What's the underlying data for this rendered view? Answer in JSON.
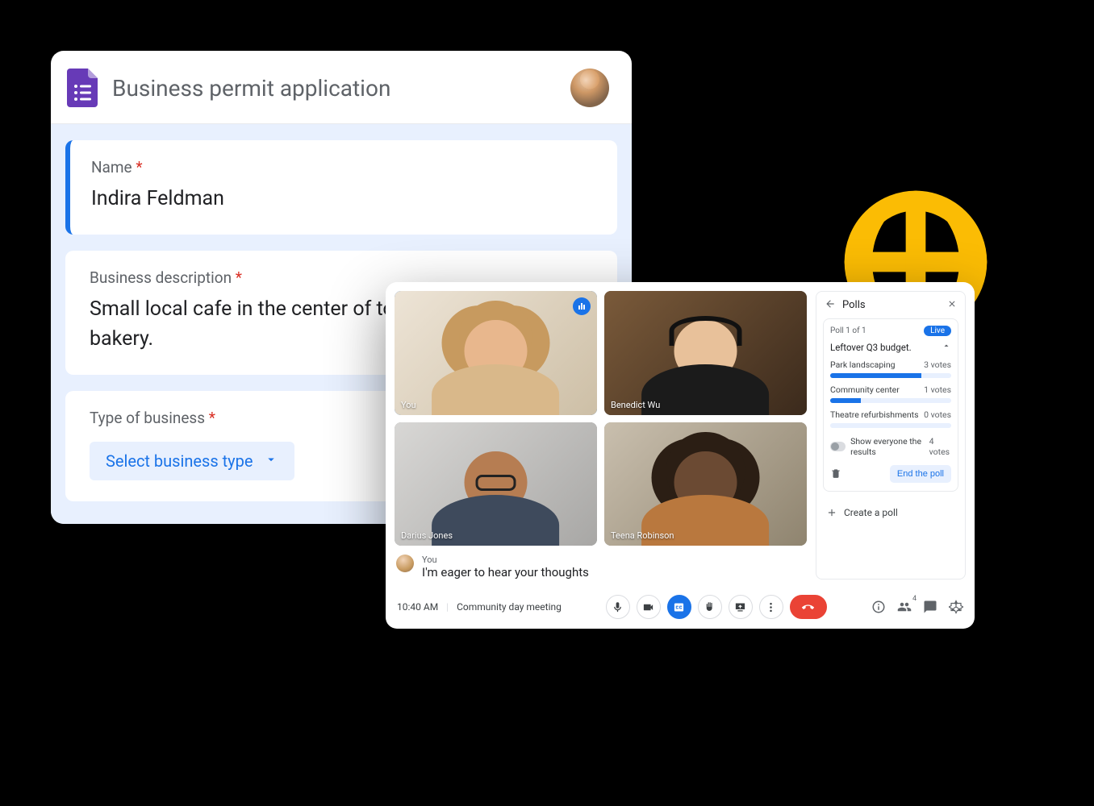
{
  "form": {
    "title": "Business permit application",
    "questions": {
      "name": {
        "label": "Name",
        "required": "*",
        "value": "Indira Feldman"
      },
      "desc": {
        "label": "Business description",
        "required": "*",
        "value": "Small local cafe in the center of town with an onsite bakery."
      },
      "type": {
        "label": "Type of business",
        "required": "*",
        "select_label": "Select business type"
      }
    }
  },
  "meet": {
    "time": "10:40 AM",
    "meeting_name": "Community day meeting",
    "participants_count": "4",
    "tiles": {
      "t1": "You",
      "t2": "Benedict Wu",
      "t3": "Darius Jones",
      "t4": "Teena Robinson"
    },
    "caption": {
      "who": "You",
      "line": "I'm eager to hear your thoughts"
    }
  },
  "polls": {
    "title": "Polls",
    "counter": "Poll 1 of 1",
    "live": "Live",
    "question": "Leftover Q3 budget.",
    "options": {
      "o1": {
        "label": "Park landscaping",
        "votes": "3 votes",
        "pct": 75
      },
      "o2": {
        "label": "Community center",
        "votes": "1 votes",
        "pct": 25
      },
      "o3": {
        "label": "Theatre refurbishments",
        "votes": "0 votes",
        "pct": 0
      }
    },
    "show_results_label": "Show everyone the results",
    "total_votes": "4 votes",
    "end_label": "End the poll",
    "create_label": "Create a poll"
  }
}
